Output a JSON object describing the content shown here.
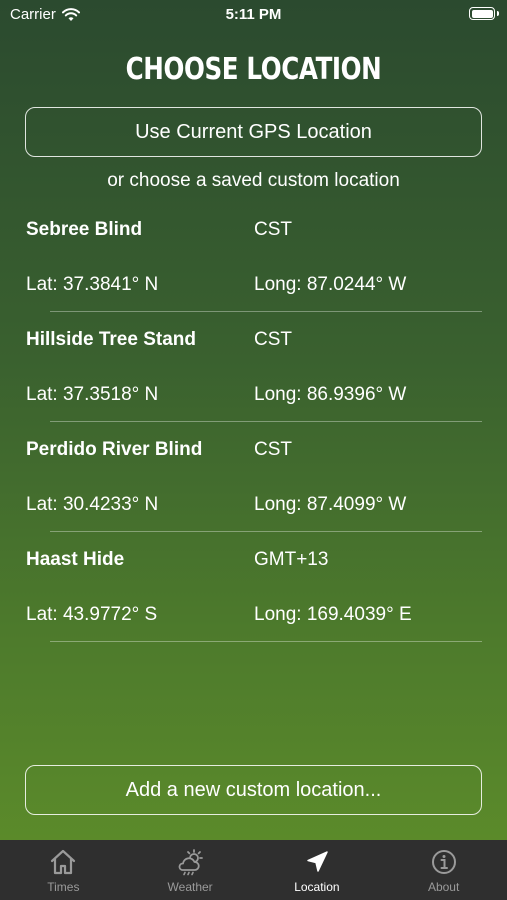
{
  "status_bar": {
    "carrier": "Carrier",
    "time": "5:11 PM"
  },
  "page": {
    "title": "CHOOSE LOCATION",
    "gps_button_label": "Use Current GPS Location",
    "subtitle": "or choose a saved custom location",
    "add_button_label": "Add a new custom location..."
  },
  "locations": [
    {
      "name": "Sebree Blind",
      "timezone": "CST",
      "lat": "Lat: 37.3841° N",
      "long": "Long: 87.0244° W"
    },
    {
      "name": "Hillside Tree Stand",
      "timezone": "CST",
      "lat": "Lat: 37.3518° N",
      "long": "Long: 86.9396° W"
    },
    {
      "name": "Perdido River Blind",
      "timezone": "CST",
      "lat": "Lat: 30.4233° N",
      "long": "Long: 87.4099° W"
    },
    {
      "name": "Haast Hide",
      "timezone": "GMT+13",
      "lat": "Lat: 43.9772° S",
      "long": "Long: 169.4039° E"
    }
  ],
  "tabs": [
    {
      "label": "Times",
      "icon": "home-icon",
      "active": false
    },
    {
      "label": "Weather",
      "icon": "weather-icon",
      "active": false
    },
    {
      "label": "Location",
      "icon": "location-arrow-icon",
      "active": true
    },
    {
      "label": "About",
      "icon": "info-icon",
      "active": false
    }
  ],
  "colors": {
    "background_top": "#2b4a2f",
    "background_bottom": "#5f8f2a",
    "tab_bar": "#2f2f2f",
    "tab_active": "#ffffff",
    "tab_inactive": "#9a9a9a"
  }
}
